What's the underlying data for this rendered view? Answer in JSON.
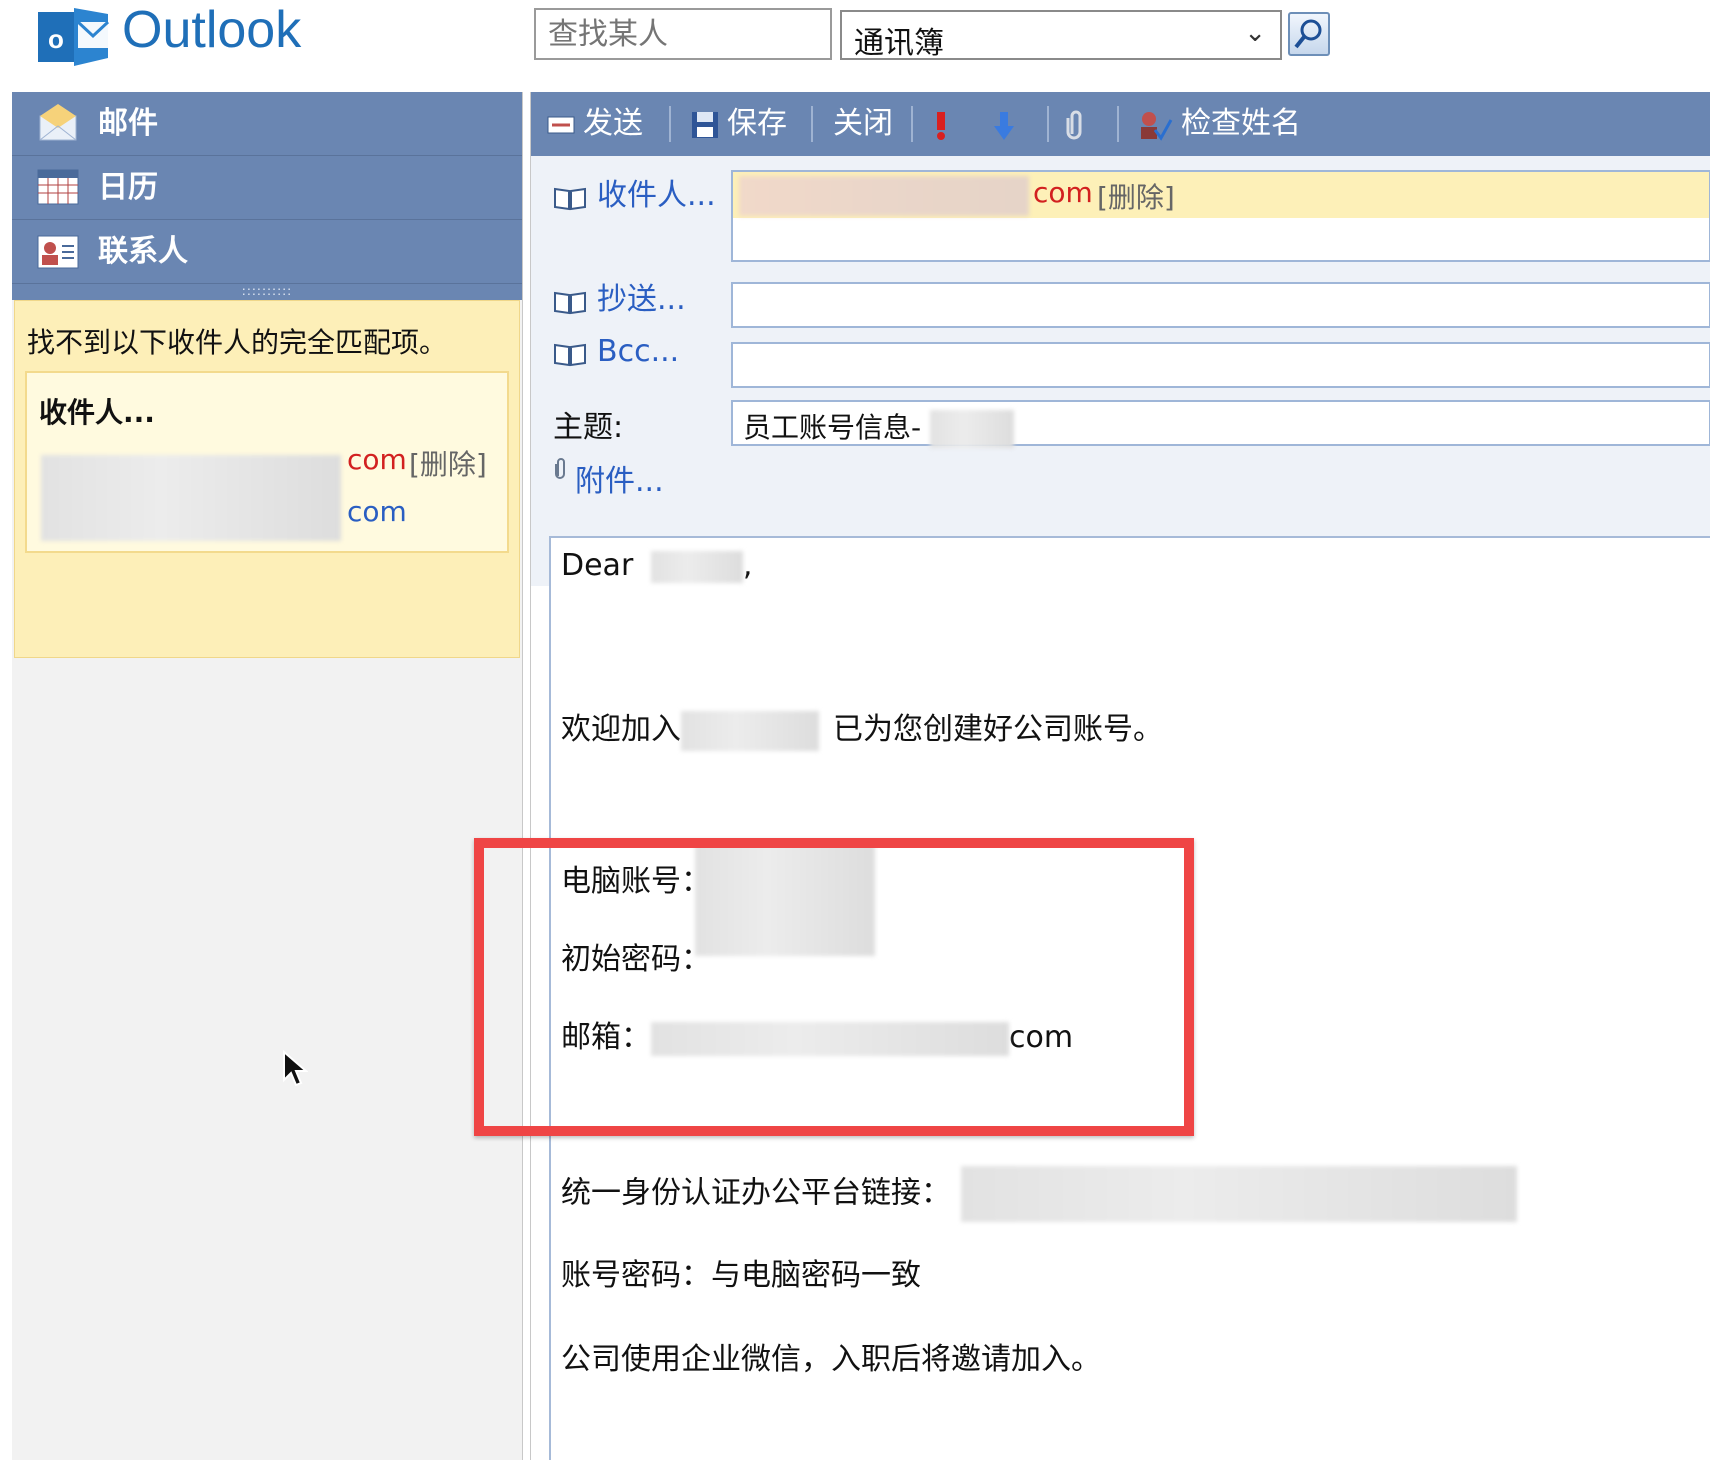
{
  "header": {
    "app_name": "Outlook",
    "search_placeholder": "查找某人",
    "address_book_value": "通讯簿"
  },
  "nav": {
    "items": [
      {
        "label": "邮件",
        "icon": "mail-icon"
      },
      {
        "label": "日历",
        "icon": "calendar-icon"
      },
      {
        "label": "联系人",
        "icon": "contacts-icon"
      }
    ],
    "grip": "::::::::::"
  },
  "warning": {
    "message": "找不到以下收件人的完全匹配项。",
    "recipients_label": "收件人...",
    "line1_suffix": "com",
    "line1_action": "[删除]",
    "line2_suffix": "com"
  },
  "toolbar": {
    "send": "发送",
    "save": "保存",
    "close": "关闭",
    "check_names": "检查姓名"
  },
  "compose": {
    "to_label": "收件人...",
    "to_suffix": "com",
    "to_action": "[删除]",
    "cc_label": "抄送...",
    "bcc_label": "Bcc...",
    "subject_label": "主题:",
    "subject_value": "员工账号信息-",
    "attach_label": "附件..."
  },
  "body": {
    "greeting": "Dear",
    "greeting_punct": ",",
    "welcome_prefix": "欢迎加入",
    "welcome_suffix": "已为您创建好公司账号。",
    "pc_account_label": "电脑账号：",
    "initial_password_label": "初始密码：",
    "email_label": "邮箱：",
    "email_suffix": "com",
    "sso_label": "统一身份认证办公平台链接：",
    "account_password_line": "账号密码：与电脑密码一致",
    "wechat_line": "公司使用企业微信，入职后将邀请加入。"
  },
  "colors": {
    "nav_bar": "#6a86b2",
    "highlight_frame": "#ef4545",
    "link_blue": "#2a5ec2",
    "warning_bg": "#fdefb8"
  }
}
